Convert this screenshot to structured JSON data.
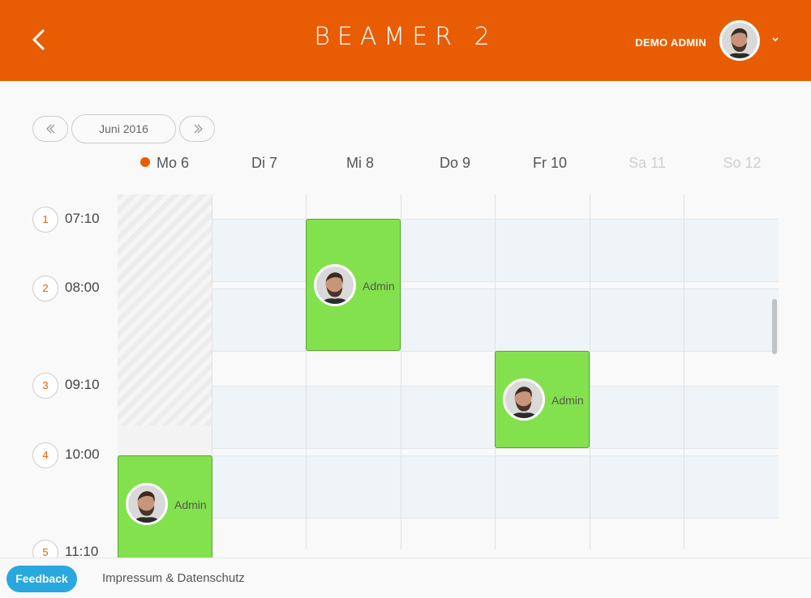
{
  "header": {
    "title": "BEAMER 2",
    "user_name": "DEMO ADMIN",
    "brand_color": "#e85d04"
  },
  "calendar_nav": {
    "month": "Juni 2016"
  },
  "days": [
    {
      "label": "Mo 6",
      "today": true
    },
    {
      "label": "Di 7"
    },
    {
      "label": "Mi 8"
    },
    {
      "label": "Do 9"
    },
    {
      "label": "Fr 10"
    },
    {
      "label": "Sa 11",
      "weekend": true
    },
    {
      "label": "So 12",
      "weekend": true
    }
  ],
  "slots": [
    {
      "num": "1",
      "time": "07:10"
    },
    {
      "num": "2",
      "time": "08:00"
    },
    {
      "num": "3",
      "time": "09:10"
    },
    {
      "num": "4",
      "time": "10:00"
    },
    {
      "num": "5",
      "time": "11:10"
    }
  ],
  "events": [
    {
      "day": "Mi 8",
      "slot": "2",
      "name": "Admin"
    },
    {
      "day": "Fr 10",
      "slot": "3",
      "name": "Admin"
    },
    {
      "day": "Mo 6",
      "slot": "4",
      "name": "Admin"
    }
  ],
  "footer": {
    "feedback": "Feedback",
    "imprint": "Impressum & Datenschutz"
  },
  "icons": {
    "back": "chevron-left-icon",
    "prev": "double-chevron-left-icon",
    "next": "double-chevron-right-icon",
    "caret": "chevron-down-icon"
  },
  "colors": {
    "event_green": "#83e14d",
    "feedback_blue": "#29a7df"
  }
}
